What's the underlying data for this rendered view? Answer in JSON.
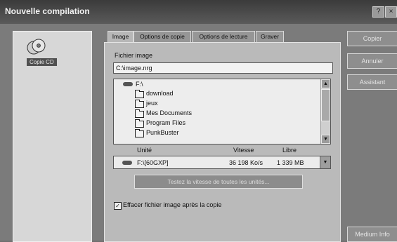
{
  "window": {
    "title": "Nouvelle compilation"
  },
  "left": {
    "item_label": "Copie CD"
  },
  "tabs": [
    "Image",
    "Options de copie",
    "Options de lecture",
    "Graver"
  ],
  "image_file": {
    "label": "Fichier image",
    "value": "C:\\image.nrg"
  },
  "tree": {
    "root": "F:\\",
    "folders": [
      "download",
      "jeux",
      "Mes Documents",
      "Program Files",
      "PunkBuster"
    ]
  },
  "drives": {
    "headers": {
      "unit": "Unité",
      "speed": "Vitesse",
      "free": "Libre"
    },
    "row": {
      "unit": "F:\\[60GXP]",
      "speed": "36 198 Ko/s",
      "free": "1 339 MB"
    }
  },
  "test_button": "Testez la vitesse de toutes les unités...",
  "delete_checkbox": {
    "label": "Effacer fichier image après la copie",
    "checked": true
  },
  "right_buttons": {
    "copy": "Copier",
    "cancel": "Annuler",
    "wizard": "Assistant",
    "info": "Medium Info"
  }
}
